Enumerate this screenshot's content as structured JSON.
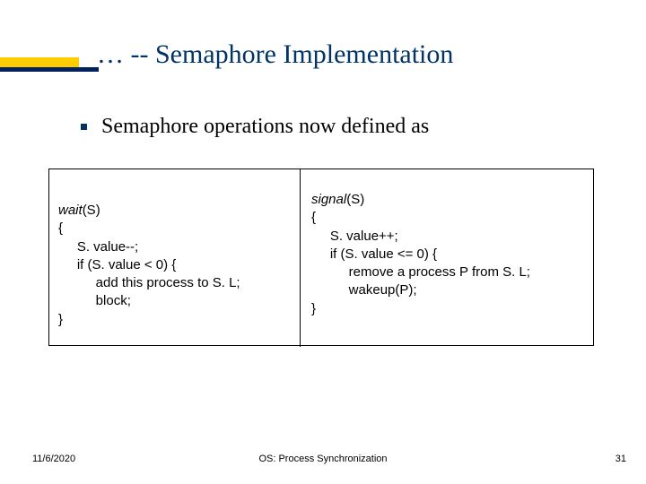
{
  "title": "… -- Semaphore Implementation",
  "bullet": "Semaphore operations now defined as",
  "code_left": {
    "l1a": "wait",
    "l1b": "(S)",
    "l2": "{",
    "l3": "     S. value--;",
    "l4": "     if (S. value < 0) {",
    "l5": "          add this process to S. L;",
    "l6": "          block;",
    "l7": "}"
  },
  "code_right": {
    "l1a": "signal",
    "l1b": "(S)",
    "l2": "{",
    "l3": "     S. value++;",
    "l4": "     if (S. value <= 0) {",
    "l5": "          remove a process P from S. L;",
    "l6": "          wakeup(P);",
    "l7": "}"
  },
  "footer": {
    "date": "11/6/2020",
    "center": "OS: Process Synchronization",
    "page": "31"
  }
}
